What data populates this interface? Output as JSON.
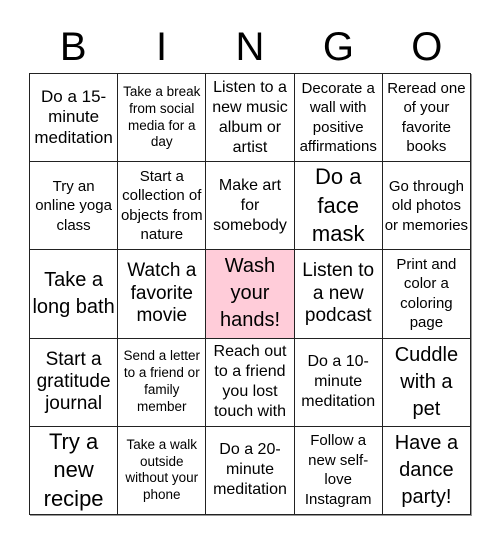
{
  "header": {
    "letters": [
      "B",
      "I",
      "N",
      "G",
      "O"
    ]
  },
  "card": {
    "free_color": "#ffccd9",
    "cells": [
      [
        "Do a 15-minute meditation",
        "Take a break from social media for a day",
        "Listen to a new music album or artist",
        "Decorate a wall with positive affirmations",
        "Reread one of your favorite books"
      ],
      [
        "Try an online yoga class",
        "Start a collection of objects from nature",
        "Make art for somebody",
        "Do a face mask",
        "Go through old photos or memories"
      ],
      [
        "Take a long bath",
        "Watch a favorite movie",
        "Wash your hands!",
        "Listen to a new podcast",
        "Print and color a coloring page"
      ],
      [
        "Start a gratitude journal",
        "Send a letter to a friend or family member",
        "Reach out to a friend you lost touch with",
        "Do a 10-minute meditation",
        "Cuddle with a pet"
      ],
      [
        "Try a new recipe",
        "Take a walk outside without your phone",
        "Do a 20-minute meditation",
        "Follow a new self-love Instagram",
        "Have a dance party!"
      ]
    ],
    "free_cell": {
      "row": 2,
      "col": 2
    }
  }
}
